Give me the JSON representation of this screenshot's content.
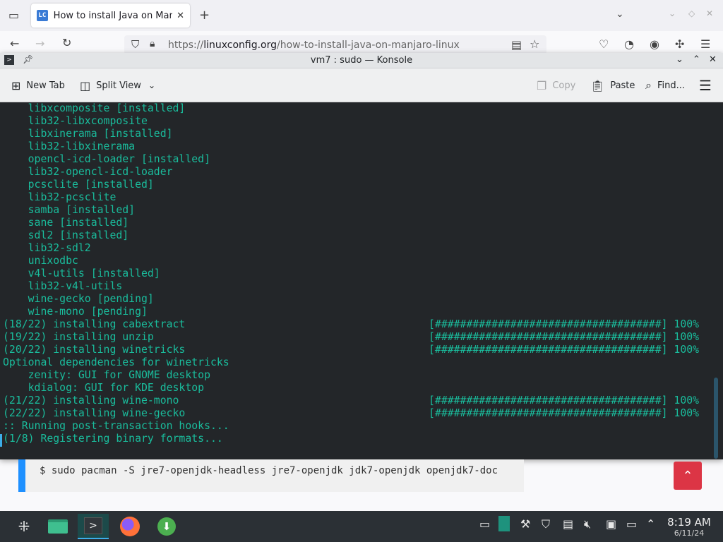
{
  "browser": {
    "tab_title": "How to install Java on Manjaro",
    "favicon_text": "LC",
    "url_prefix": "https://",
    "url_domain": "linuxconfig.org",
    "url_path": "/how-to-install-java-on-manjaro-linux"
  },
  "konsole": {
    "title": "vm7 : sudo — Konsole",
    "toolbar": {
      "new_tab": "New Tab",
      "split_view": "Split View",
      "copy": "Copy",
      "paste": "Paste",
      "find": "Find..."
    },
    "lines": [
      {
        "text": "    libxcomposite [installed]",
        "bar": ""
      },
      {
        "text": "    lib32-libxcomposite",
        "bar": ""
      },
      {
        "text": "    libxinerama [installed]",
        "bar": ""
      },
      {
        "text": "    lib32-libxinerama",
        "bar": ""
      },
      {
        "text": "    opencl-icd-loader [installed]",
        "bar": ""
      },
      {
        "text": "    lib32-opencl-icd-loader",
        "bar": ""
      },
      {
        "text": "    pcsclite [installed]",
        "bar": ""
      },
      {
        "text": "    lib32-pcsclite",
        "bar": ""
      },
      {
        "text": "    samba [installed]",
        "bar": ""
      },
      {
        "text": "    sane [installed]",
        "bar": ""
      },
      {
        "text": "    sdl2 [installed]",
        "bar": ""
      },
      {
        "text": "    lib32-sdl2",
        "bar": ""
      },
      {
        "text": "    unixodbc",
        "bar": ""
      },
      {
        "text": "    v4l-utils [installed]",
        "bar": ""
      },
      {
        "text": "    lib32-v4l-utils",
        "bar": ""
      },
      {
        "text": "    wine-gecko [pending]",
        "bar": ""
      },
      {
        "text": "    wine-mono [pending]",
        "bar": ""
      },
      {
        "text": "(18/22) installing cabextract",
        "bar": "[####################################] 100%"
      },
      {
        "text": "(19/22) installing unzip",
        "bar": "[####################################] 100%"
      },
      {
        "text": "(20/22) installing winetricks",
        "bar": "[####################################] 100%"
      },
      {
        "text": "Optional dependencies for winetricks",
        "bar": ""
      },
      {
        "text": "    zenity: GUI for GNOME desktop",
        "bar": ""
      },
      {
        "text": "    kdialog: GUI for KDE desktop",
        "bar": ""
      },
      {
        "text": "(21/22) installing wine-mono",
        "bar": "[####################################] 100%"
      },
      {
        "text": "(22/22) installing wine-gecko",
        "bar": "[####################################] 100%"
      },
      {
        "text": ":: Running post-transaction hooks...",
        "bar": ""
      },
      {
        "text": "(1/8) Registering binary formats...",
        "bar": ""
      }
    ]
  },
  "page": {
    "code_snippet": "$ sudo pacman -S jre7-openjdk-headless jre7-openjdk jdk7-openjdk openjdk7-doc"
  },
  "taskbar": {
    "time": "8:19 AM",
    "date": "6/11/24"
  },
  "colors": {
    "terminal_bg": "#232629",
    "terminal_fg": "#1abc9c",
    "accent": "#3daee9",
    "scroll_top_button": "#dc3545"
  }
}
